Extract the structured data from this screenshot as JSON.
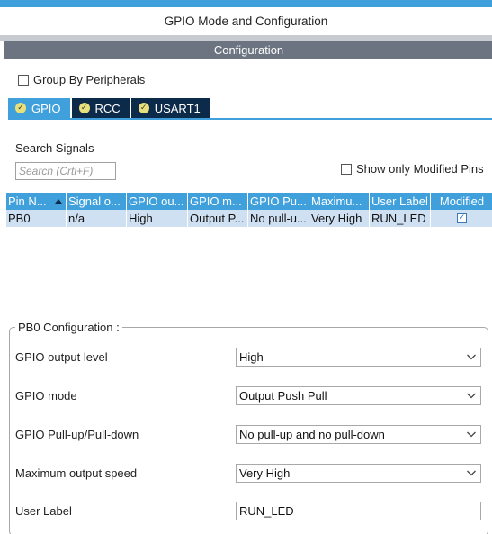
{
  "header": {
    "title": "GPIO Mode and Configuration"
  },
  "config_bar": {
    "label": "Configuration"
  },
  "group_by": {
    "label": "Group By Peripherals",
    "checked": false
  },
  "tabs": [
    {
      "label": "GPIO",
      "active": true
    },
    {
      "label": "RCC",
      "active": false
    },
    {
      "label": "USART1",
      "active": false
    }
  ],
  "search": {
    "label": "Search Signals",
    "placeholder": "Search (Crtl+F)",
    "value": ""
  },
  "show_modified": {
    "label": "Show only Modified Pins",
    "checked": false
  },
  "table": {
    "columns": [
      "Pin N...",
      "Signal o...",
      "GPIO ou...",
      "GPIO m...",
      "GPIO Pu...",
      "Maximu...",
      "User Label",
      "Modified"
    ],
    "rows": [
      {
        "pin": "PB0",
        "signal": "n/a",
        "output": "High",
        "mode": "Output P...",
        "pull": "No pull-u...",
        "speed": "Very High",
        "label": "RUN_LED",
        "modified": true
      }
    ]
  },
  "pin_config": {
    "title": "PB0 Configuration :",
    "fields": [
      {
        "label": "GPIO output level",
        "value": "High"
      },
      {
        "label": "GPIO mode",
        "value": "Output Push Pull"
      },
      {
        "label": "GPIO Pull-up/Pull-down",
        "value": "No pull-up and no pull-down"
      },
      {
        "label": "Maximum output speed",
        "value": "Very High"
      },
      {
        "label": "User Label",
        "value": "RUN_LED"
      }
    ]
  },
  "colors": {
    "accent": "#3fa0dc",
    "tab_dark": "#0c2a4a",
    "config_bar": "#6b7480",
    "row_selected": "#cfe0f3"
  }
}
